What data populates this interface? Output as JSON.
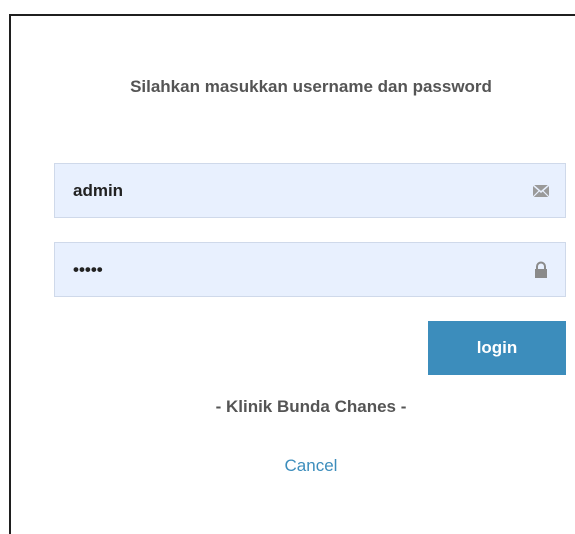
{
  "form": {
    "prompt": "Silahkan masukkan username dan password",
    "username_value": "admin",
    "password_value": "admin",
    "login_label": "login",
    "clinic_name": "- Klinik Bunda Chanes -",
    "cancel_label": "Cancel"
  },
  "icons": {
    "username": "envelope-icon",
    "password": "lock-icon"
  },
  "colors": {
    "accent": "#3c8dbc",
    "field_bg": "#e8f0fe",
    "text": "#555555"
  }
}
